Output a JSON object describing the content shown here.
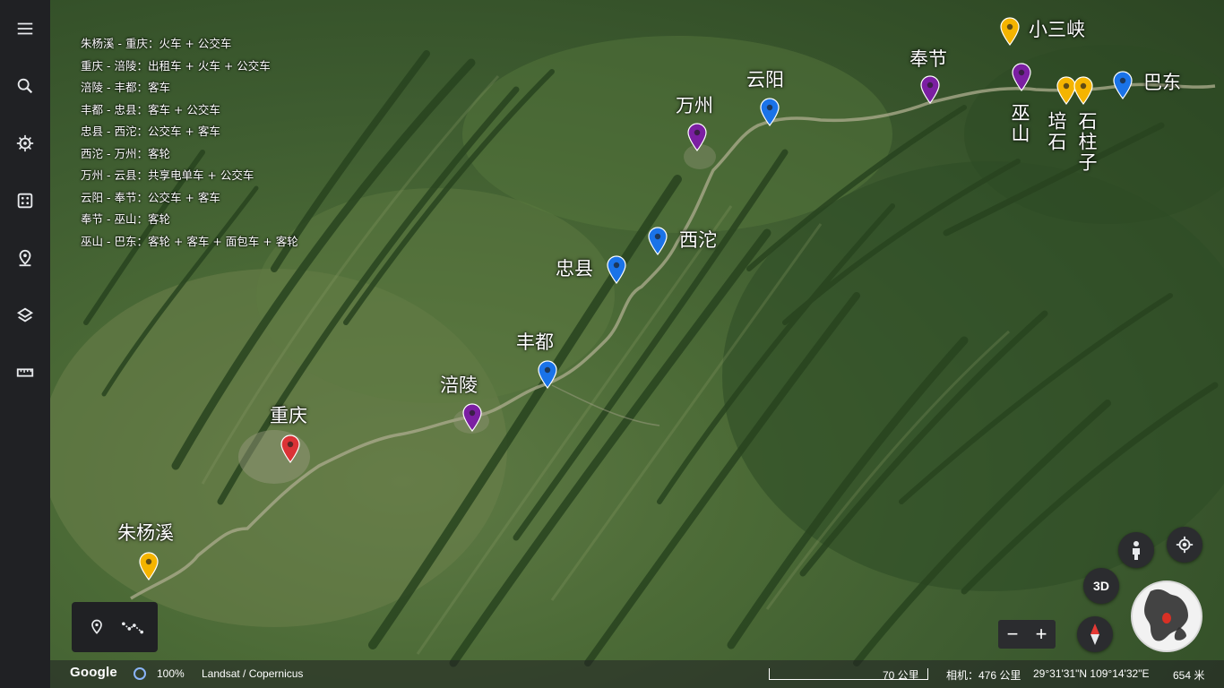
{
  "brand": "Google",
  "sidebar": {
    "items": [
      {
        "name": "menu-icon"
      },
      {
        "name": "search-icon"
      },
      {
        "name": "voyager-icon"
      },
      {
        "name": "dice-icon"
      },
      {
        "name": "projects-icon"
      },
      {
        "name": "layers-icon"
      },
      {
        "name": "ruler-icon"
      }
    ]
  },
  "routes": [
    {
      "text": "朱杨溪 - 重庆：火车 + 公交车"
    },
    {
      "text": "重庆    -    涪陵：出租车 + 火车 + 公交车"
    },
    {
      "text": "涪陵    -    丰都：客车"
    },
    {
      "text": "丰都    -    忠县：客车 + 公交车"
    },
    {
      "text": "忠县    -    西沱：公交车 + 客车"
    },
    {
      "text": "西沱    -    万州：客轮"
    },
    {
      "text": "万州    -    云县：共享电单车 + 公交车"
    },
    {
      "text": "云阳    -    奉节：公交车 + 客车"
    },
    {
      "text": "奉节    -    巫山：客轮"
    },
    {
      "text": "巫山    -    巴东：客轮 + 客车 + 面包车 + 客轮"
    }
  ],
  "places": [
    {
      "label": "朱杨溪",
      "color": "#f4b400"
    },
    {
      "label": "重庆",
      "color": "#db3236"
    },
    {
      "label": "涪陵",
      "color": "#7b1fa2"
    },
    {
      "label": "丰都",
      "color": "#1a73e8"
    },
    {
      "label": "忠县",
      "color": "#1a73e8"
    },
    {
      "label": "西沱",
      "color": "#1a73e8"
    },
    {
      "label": "万州",
      "color": "#7b1fa2"
    },
    {
      "label": "云阳",
      "color": "#1a73e8"
    },
    {
      "label": "奉节",
      "color": "#7b1fa2"
    },
    {
      "label": "巫山",
      "color": "#7b1fa2"
    },
    {
      "label": "小三峡",
      "color": "#f4b400"
    },
    {
      "label": "培石",
      "color": "#f4b400"
    },
    {
      "label": "石柱子",
      "color": "#f4b400"
    },
    {
      "label": "巴东",
      "color": "#1a73e8"
    }
  ],
  "controls": {
    "btn_3d": "3D",
    "zoom_out": "−",
    "zoom_in": "+"
  },
  "status": {
    "loading": "100%",
    "imagery": "Landsat / Copernicus",
    "scale": "70 公里",
    "camera": "相机：476 公里",
    "coords": "29°31'31\"N 109°14'32\"E",
    "elevation": "654 米"
  }
}
